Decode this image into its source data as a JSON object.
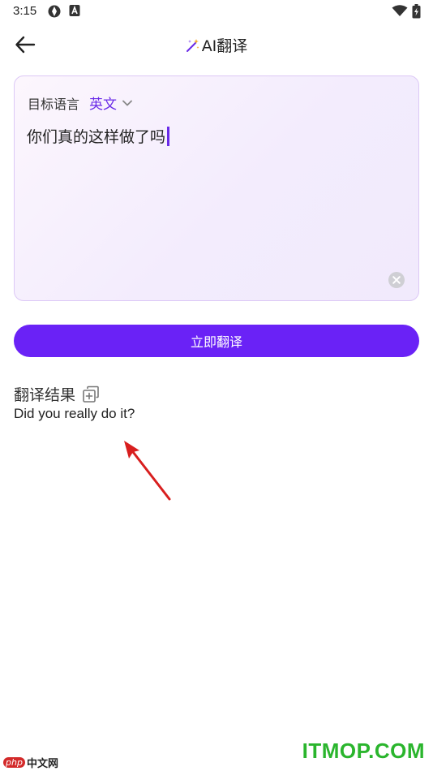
{
  "status_bar": {
    "time": "3:15"
  },
  "app_bar": {
    "title": "AI翻译"
  },
  "input_card": {
    "target_language_label": "目标语言",
    "target_language_value": "英文",
    "source_text": "你们真的这样做了吗"
  },
  "translate_button": {
    "label": "立即翻译"
  },
  "result": {
    "header": "翻译结果",
    "text": "Did you really do it?"
  },
  "watermarks": {
    "left_badge": "php",
    "left_text": "中文网",
    "right_text": "ITMOP.COM"
  },
  "colors": {
    "accent": "#6a22f6",
    "accent_text": "#6a2be8",
    "card_border": "#dcc8f6",
    "annotation_arrow": "#d81e1e",
    "watermark_green": "#2ab52d"
  }
}
